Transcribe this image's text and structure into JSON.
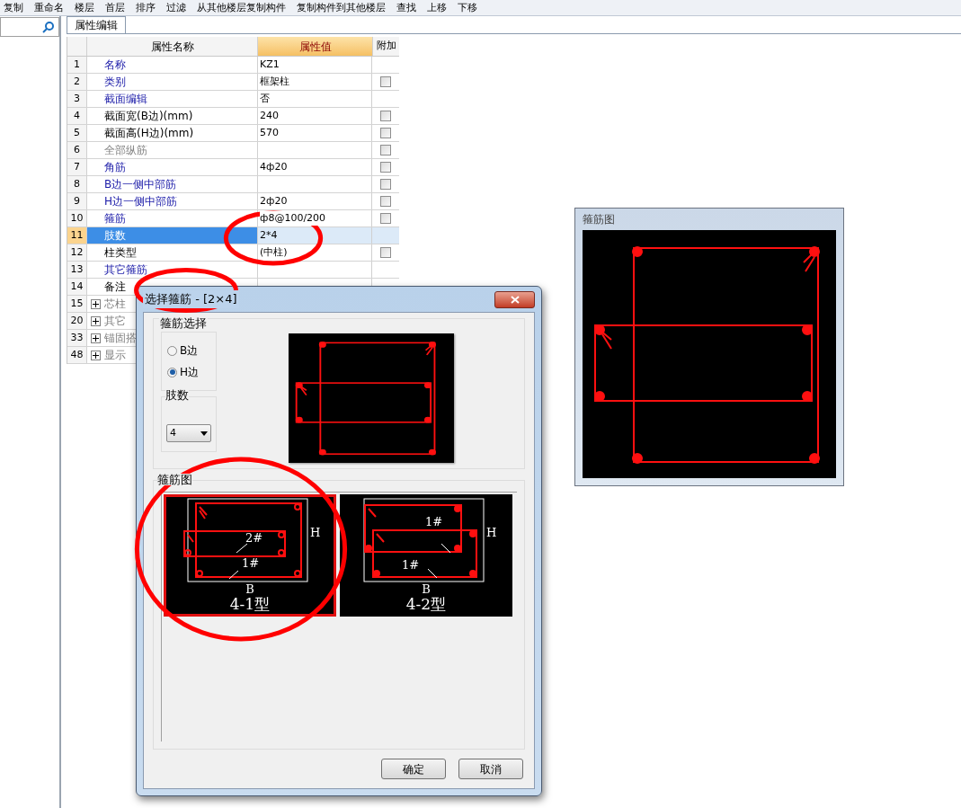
{
  "toolbar": {
    "items": [
      "复制",
      "重命名",
      "楼层",
      "首层",
      "排序",
      "过滤",
      "从其他楼层复制构件",
      "复制构件到其他楼层",
      "查找",
      "上移",
      "下移"
    ]
  },
  "tabs": [
    {
      "label": "属性编辑",
      "selected": true
    }
  ],
  "table": {
    "columns": [
      "属性名称",
      "属性值",
      "附加"
    ],
    "rows": [
      {
        "num": "1",
        "name": "名称",
        "kind": "blue",
        "value": "KZ1",
        "selected": false
      },
      {
        "num": "2",
        "name": "类别",
        "kind": "blue",
        "value": "框架柱",
        "checked": false,
        "selected": false
      },
      {
        "num": "3",
        "name": "截面编辑",
        "kind": "blue",
        "value": "否",
        "selected": false
      },
      {
        "num": "4",
        "name": "截面宽(B边)(mm)",
        "kind": "black",
        "value": "240",
        "checked": false,
        "selected": false
      },
      {
        "num": "5",
        "name": "截面高(H边)(mm)",
        "kind": "black",
        "value": "570",
        "checked": false,
        "selected": false
      },
      {
        "num": "6",
        "name": "全部纵筋",
        "kind": "gray",
        "value": "",
        "checked": false,
        "selected": false
      },
      {
        "num": "7",
        "name": "角筋",
        "kind": "blue",
        "value": "4ф20",
        "checked": false,
        "selected": false
      },
      {
        "num": "8",
        "name": "B边一侧中部筋",
        "kind": "blue",
        "value": "",
        "checked": false,
        "selected": false
      },
      {
        "num": "9",
        "name": "H边一侧中部筋",
        "kind": "blue",
        "value": "2ф20",
        "checked": false,
        "selected": false
      },
      {
        "num": "10",
        "name": "箍筋",
        "kind": "blue",
        "value": "ф8@100/200",
        "checked": false,
        "selected": false
      },
      {
        "num": "11",
        "name": "肢数",
        "kind": "blue",
        "value": "2*4",
        "selected": true
      },
      {
        "num": "12",
        "name": "柱类型",
        "kind": "black",
        "value": "(中柱)",
        "checked": false,
        "selected": false
      },
      {
        "num": "13",
        "name": "其它箍筋",
        "kind": "blue",
        "value": "",
        "selected": false
      },
      {
        "num": "14",
        "name": "备注",
        "kind": "black",
        "value": "",
        "selected": false
      },
      {
        "num": "15",
        "name": "芯柱",
        "kind": "gray",
        "expanded": false,
        "selected": false
      },
      {
        "num": "20",
        "name": "其它",
        "kind": "gray",
        "expanded": false,
        "selected": false
      },
      {
        "num": "33",
        "name": "锚固搭",
        "kind": "gray",
        "expanded": false,
        "selected": false
      },
      {
        "num": "48",
        "name": "显示",
        "kind": "gray",
        "expanded": false,
        "selected": false
      }
    ]
  },
  "preview_panel": {
    "title": "箍筋图"
  },
  "dialog": {
    "title": "选择箍筋 - [2×4]",
    "stirrup_group": {
      "title": "箍筋选择",
      "radios": [
        {
          "label": "B边",
          "selected": false
        },
        {
          "label": "H边",
          "selected": true
        }
      ]
    },
    "legs_group": {
      "title": "肢数",
      "value": "4"
    },
    "diagram_group": {
      "title": "箍筋图",
      "options": [
        {
          "label": "4-1型",
          "selected": true,
          "marks": [
            "2#",
            "1#"
          ],
          "h": "H",
          "b": "B",
          "kind": "inner-horizontal"
        },
        {
          "label": "4-2型",
          "selected": false,
          "marks": [
            "1#",
            "1#"
          ],
          "h": "H",
          "b": "B",
          "kind": "overlap"
        }
      ]
    },
    "buttons": [
      "确定",
      "取消"
    ]
  }
}
